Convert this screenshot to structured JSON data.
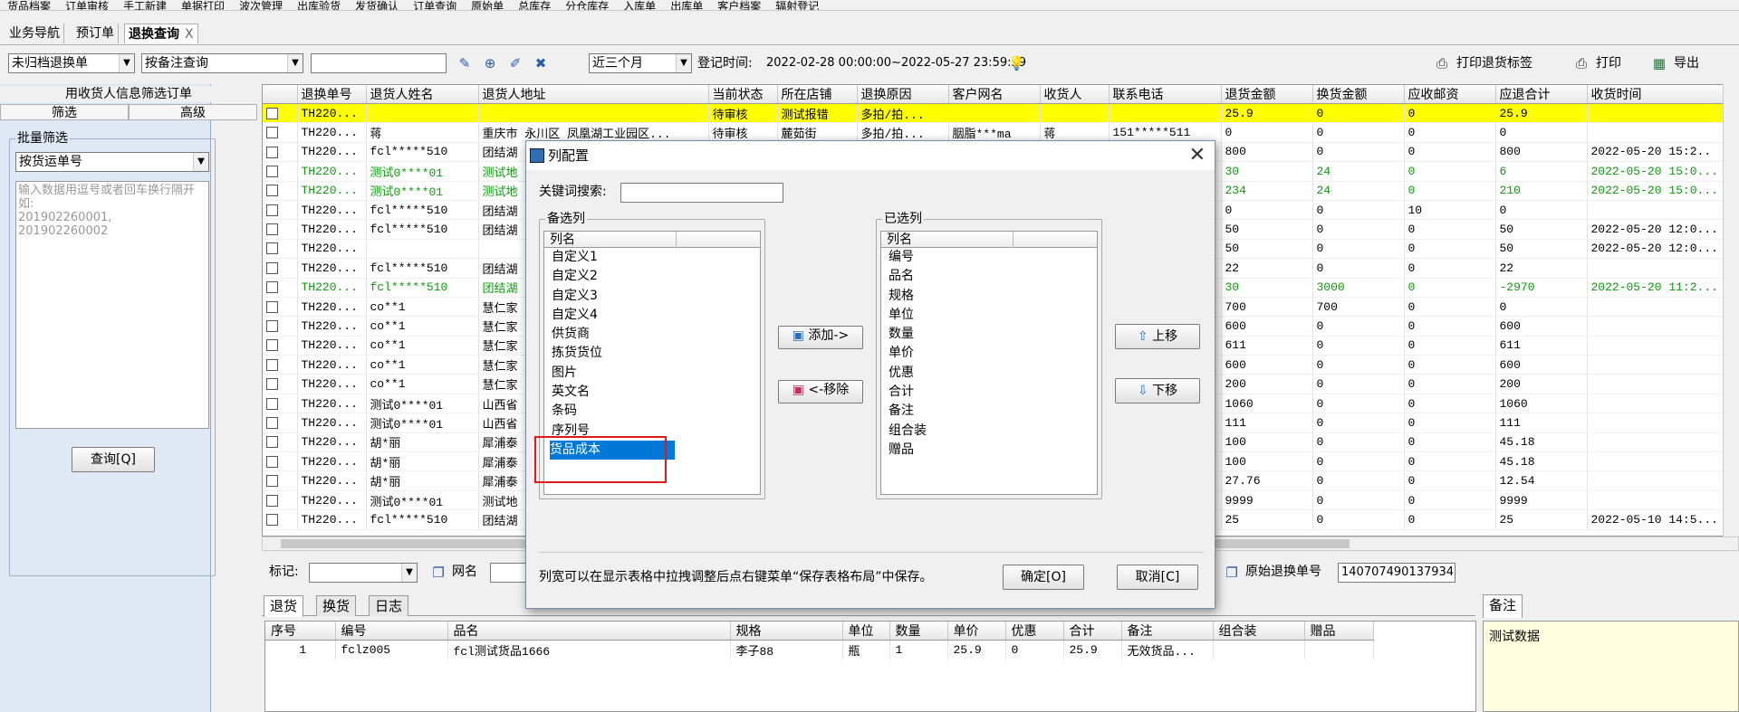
{
  "menu": [
    "货品档案",
    "订单审核",
    "手工新建",
    "单据打印",
    "波次管理",
    "出库验货",
    "发货确认",
    "订单查询",
    "原始单",
    "总库存",
    "分仓库存",
    "入库单",
    "出库单",
    "客户档案",
    "辐射登记"
  ],
  "tabs": {
    "nav": "业务导航",
    "preorder": "预订单",
    "exchange": "退换查询",
    "close": "X"
  },
  "toolbar": {
    "archive_filter": "未归档退换单",
    "query_mode": "按备注查询",
    "search_value": "",
    "date_range": "近三个月",
    "reg_time_label": "登记时间:",
    "reg_time_value": "2022-02-28 00:00:00~2022-05-27 23:59:59",
    "print_label_btn": "打印退货标签",
    "print_btn": "打印",
    "export_btn": "导出"
  },
  "left": {
    "header": "用收货人信息筛选订单",
    "tab_filter": "筛选",
    "tab_advanced": "高级",
    "batch_title": "批量筛选",
    "batch_mode": "按货运单号",
    "placeholder": "输入数据用逗号或者回车换行隔开\n如:\n201902260001,\n201902260002",
    "query_btn": "查询[Q]"
  },
  "grid": {
    "columns": [
      "退换单号",
      "退货人姓名",
      "退货人地址",
      "当前状态",
      "所在店铺",
      "退换原因",
      "客户网名",
      "收货人",
      "联系电话",
      "退货金额",
      "换货金额",
      "应收邮资",
      "应退合计",
      "收货时间"
    ],
    "rows": [
      {
        "style": "hl",
        "cells": [
          "TH220...",
          "",
          "",
          "待审核",
          "测试报错",
          "多拍/拍...",
          "",
          "",
          "",
          "25.9",
          "0",
          "0",
          "25.9",
          ""
        ]
      },
      {
        "style": "",
        "cells": [
          "TH220...",
          "蒋",
          "重庆市 永川区 凤凰湖工业园区...",
          "待审核",
          "麓茹街",
          "多拍/拍...",
          "胭脂***ma",
          "蒋",
          "151*****511",
          "0",
          "0",
          "0",
          "0",
          ""
        ]
      },
      {
        "style": "",
        "cells": [
          "TH220...",
          "fcl*****510",
          "团结湖",
          "",
          "",
          "",
          "",
          "",
          "",
          "800",
          "0",
          "0",
          "800",
          "2022-05-20 15:2.."
        ]
      },
      {
        "style": "green",
        "cells": [
          "TH220...",
          "测试0****01",
          "测试地",
          "",
          "",
          "",
          "",
          "",
          "",
          "30",
          "24",
          "0",
          "6",
          "2022-05-20 15:0..."
        ]
      },
      {
        "style": "green",
        "cells": [
          "TH220...",
          "测试0****01",
          "测试地",
          "",
          "",
          "",
          "",
          "",
          "",
          "234",
          "24",
          "0",
          "210",
          "2022-05-20 15:0..."
        ]
      },
      {
        "style": "",
        "cells": [
          "TH220...",
          "fcl*****510",
          "团结湖",
          "",
          "",
          "",
          "",
          "",
          "",
          "0",
          "0",
          "10",
          "0",
          ""
        ]
      },
      {
        "style": "",
        "cells": [
          "TH220...",
          "fcl*****510",
          "团结湖",
          "",
          "",
          "",
          "",
          "",
          "",
          "50",
          "0",
          "0",
          "50",
          "2022-05-20 12:0..."
        ]
      },
      {
        "style": "",
        "cells": [
          "TH220...",
          "",
          "",
          "",
          "",
          "",
          "",
          "",
          "",
          "50",
          "0",
          "0",
          "50",
          "2022-05-20 12:0..."
        ]
      },
      {
        "style": "",
        "cells": [
          "TH220...",
          "fcl*****510",
          "团结湖",
          "",
          "",
          "",
          "",
          "",
          "",
          "22",
          "0",
          "0",
          "22",
          ""
        ]
      },
      {
        "style": "green",
        "cells": [
          "TH220...",
          "fcl*****510",
          "团结湖",
          "",
          "",
          "",
          "",
          "",
          "",
          "30",
          "3000",
          "0",
          "-2970",
          "2022-05-20 11:2..."
        ]
      },
      {
        "style": "",
        "cells": [
          "TH220...",
          "co**1",
          "慧仁家",
          "",
          "",
          "",
          "",
          "",
          "",
          "700",
          "700",
          "0",
          "0",
          ""
        ]
      },
      {
        "style": "",
        "cells": [
          "TH220...",
          "co**1",
          "慧仁家",
          "",
          "",
          "",
          "",
          "",
          "",
          "600",
          "0",
          "0",
          "600",
          ""
        ]
      },
      {
        "style": "",
        "cells": [
          "TH220...",
          "co**1",
          "慧仁家",
          "",
          "",
          "",
          "",
          "",
          "",
          "611",
          "0",
          "0",
          "611",
          ""
        ]
      },
      {
        "style": "",
        "cells": [
          "TH220...",
          "co**1",
          "慧仁家",
          "",
          "",
          "",
          "",
          "",
          "",
          "600",
          "0",
          "0",
          "600",
          ""
        ]
      },
      {
        "style": "",
        "cells": [
          "TH220...",
          "co**1",
          "慧仁家",
          "",
          "",
          "",
          "",
          "",
          "",
          "200",
          "0",
          "0",
          "200",
          ""
        ]
      },
      {
        "style": "",
        "cells": [
          "TH220...",
          "测试0****01",
          "山西省",
          "",
          "",
          "",
          "",
          "",
          "",
          "1060",
          "0",
          "0",
          "1060",
          ""
        ]
      },
      {
        "style": "",
        "cells": [
          "TH220...",
          "测试0****01",
          "山西省",
          "",
          "",
          "",
          "",
          "",
          "",
          "111",
          "0",
          "0",
          "111",
          ""
        ]
      },
      {
        "style": "",
        "cells": [
          "TH220...",
          "胡*丽",
          "犀浦泰",
          "",
          "",
          "",
          "",
          "",
          "",
          "100",
          "0",
          "0",
          "45.18",
          ""
        ]
      },
      {
        "style": "",
        "cells": [
          "TH220...",
          "胡*丽",
          "犀浦泰",
          "",
          "",
          "",
          "",
          "",
          "",
          "100",
          "0",
          "0",
          "45.18",
          ""
        ]
      },
      {
        "style": "",
        "cells": [
          "TH220...",
          "胡*丽",
          "犀浦泰",
          "",
          "",
          "",
          "",
          "",
          "",
          "27.76",
          "0",
          "0",
          "12.54",
          ""
        ]
      },
      {
        "style": "",
        "cells": [
          "TH220...",
          "测试0****01",
          "测试地",
          "",
          "",
          "",
          "",
          "",
          "",
          "9999",
          "0",
          "0",
          "9999",
          ""
        ]
      },
      {
        "style": "",
        "cells": [
          "TH220...",
          "fcl*****510",
          "团结湖",
          "",
          "",
          "",
          "",
          "",
          "",
          "25",
          "0",
          "0",
          "25",
          "2022-05-10 14:5..."
        ]
      }
    ]
  },
  "markrow": {
    "mark_label": "标记:",
    "wangming_label": "网名",
    "orig_label": "原始退换单号",
    "orig_value": "140707490137934"
  },
  "bottom": {
    "tabs": [
      "退货",
      "换货",
      "日志"
    ],
    "columns": [
      "序号",
      "编号",
      "品名",
      "规格",
      "单位",
      "数量",
      "单价",
      "优惠",
      "合计",
      "备注",
      "组合装",
      "赠品"
    ],
    "rows": [
      [
        "1",
        "fclz005",
        "fcl测试货品1666",
        "李子88",
        "瓶",
        "1",
        "25.9",
        "0",
        "25.9",
        "无效货品...",
        "",
        ""
      ]
    ],
    "note_tab": "备注",
    "note_text": "测试数据"
  },
  "dialog": {
    "title": "列配置",
    "close": "✕",
    "search_label": "关键词搜索:",
    "search_value": "",
    "avail_title": "备选列",
    "avail_header": "列名",
    "available": [
      "自定义1",
      "自定义2",
      "自定义3",
      "自定义4",
      "供货商",
      "拣货货位",
      "图片",
      "英文名",
      "条码",
      "序列号",
      "货品成本"
    ],
    "selected_available": "货品成本",
    "sel_title": "已选列",
    "sel_header": "列名",
    "selected": [
      "编号",
      "品名",
      "规格",
      "单位",
      "数量",
      "单价",
      "优惠",
      "合计",
      "备注",
      "组合装",
      "赠品"
    ],
    "add_btn": "添加->",
    "remove_btn": "<-移除",
    "up_btn": "上移",
    "down_btn": "下移",
    "hint": "列宽可以在显示表格中拉拽调整后点右键菜单“保存表格布局”中保存。",
    "ok_btn": "确定[O]",
    "cancel_btn": "取消[C]"
  },
  "colors": {
    "highlight": "#ffff00",
    "green_text": "#119911",
    "selection": "#0078d7",
    "annotation": "#e01818",
    "panel": "#dfe8f5"
  }
}
